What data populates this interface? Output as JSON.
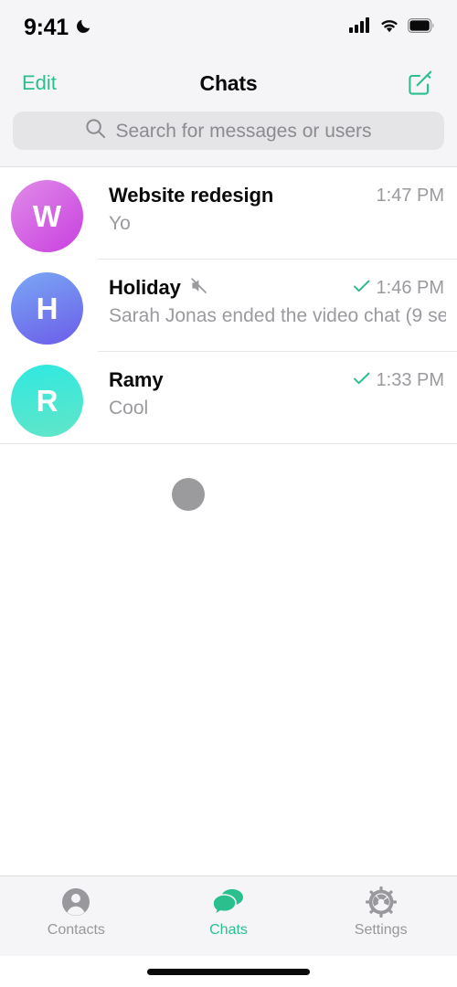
{
  "status_bar": {
    "time": "9:41",
    "dnd_icon": "moon-icon",
    "signal_icon": "cellular-signal-icon",
    "wifi_icon": "wifi-icon",
    "battery_icon": "battery-full-icon"
  },
  "nav": {
    "edit_label": "Edit",
    "title": "Chats",
    "compose_icon": "compose-icon"
  },
  "search": {
    "placeholder": "Search for messages or users",
    "value": "",
    "icon": "search-icon"
  },
  "chats": [
    {
      "name": "Website redesign",
      "preview": "Yo",
      "time": "1:47 PM",
      "avatar_letter": "W",
      "avatar_from": "#e08ce8",
      "avatar_to": "#c93fe0",
      "muted": false,
      "read_receipt": false
    },
    {
      "name": "Holiday",
      "preview": "Sarah Jonas ended the video chat (9 se…",
      "time": "1:46 PM",
      "avatar_letter": "H",
      "avatar_from": "#7aa8f5",
      "avatar_to": "#6c5ce9",
      "muted": true,
      "read_receipt": true
    },
    {
      "name": "Ramy",
      "preview": "Cool",
      "time": "1:33 PM",
      "avatar_letter": "R",
      "avatar_from": "#2fe8e0",
      "avatar_to": "#62e6c8",
      "muted": false,
      "read_receipt": true
    }
  ],
  "loading_indicator": "loading-dot",
  "tabs": [
    {
      "label": "Contacts",
      "icon": "contacts-person-icon",
      "active": false
    },
    {
      "label": "Chats",
      "icon": "chat-bubbles-icon",
      "active": true
    },
    {
      "label": "Settings",
      "icon": "gear-icon",
      "active": false
    }
  ],
  "colors": {
    "accent": "#2cbf8e",
    "header_bg": "#f5f5f7",
    "body_bg": "#ffffff",
    "secondary_text": "#9a9a9f",
    "primary_text": "#0a0a0a",
    "check_green": "#2cbf8e"
  },
  "home_indicator": "home-indicator"
}
